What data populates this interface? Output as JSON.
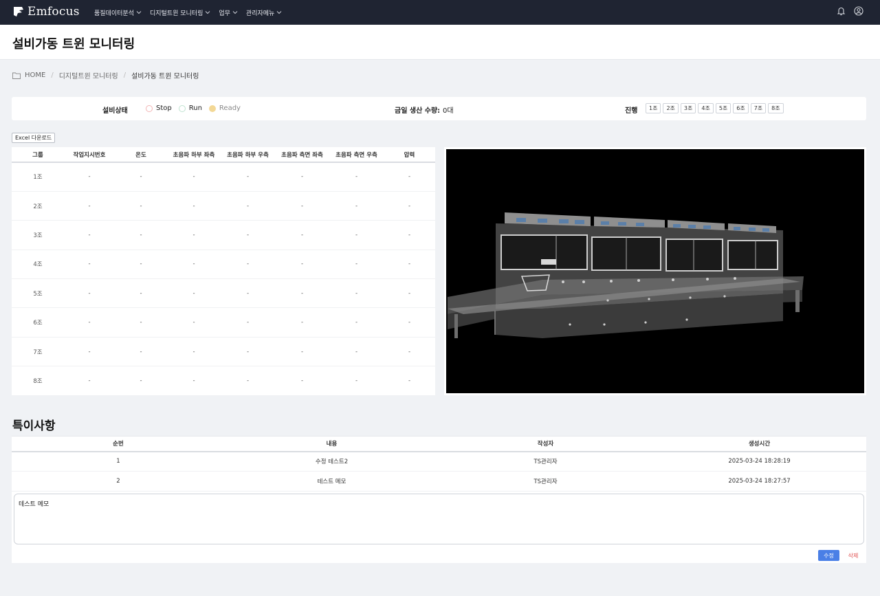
{
  "header": {
    "brand": "Emfocus",
    "nav": [
      "품질데이터분석",
      "디지털트윈 모니터링",
      "업무",
      "관리자메뉴"
    ]
  },
  "page": {
    "title": "설비가동 트윈 모니터링"
  },
  "breadcrumb": {
    "home": "HOME",
    "section": "디지털트윈 모니터링",
    "current": "설비가동 트윈 모니터링"
  },
  "status": {
    "label": "설비상태",
    "legend": [
      {
        "label": "Stop",
        "color": "#f2b4b4"
      },
      {
        "label": "Run",
        "color": "#bfe3d0"
      },
      {
        "label": "Ready",
        "color": "#f3d896"
      }
    ],
    "production_label": "금일 생산 수량:",
    "production_value": "0대",
    "progress_label": "진행",
    "groups": [
      "1조",
      "2조",
      "3조",
      "4조",
      "5조",
      "6조",
      "7조",
      "8조"
    ]
  },
  "excel_button": "Excel 다운로드",
  "data_table": {
    "headers": [
      "그룹",
      "작업지시번호",
      "온도",
      "초음파 하부 좌측",
      "초음파 하부 우측",
      "초음파 측면 좌측",
      "초음파 측면 우측",
      "압력"
    ],
    "rows": [
      [
        "1조",
        "-",
        "-",
        "-",
        "-",
        "-",
        "-",
        "-"
      ],
      [
        "2조",
        "-",
        "-",
        "-",
        "-",
        "-",
        "-",
        "-"
      ],
      [
        "3조",
        "-",
        "-",
        "-",
        "-",
        "-",
        "-",
        "-"
      ],
      [
        "4조",
        "-",
        "-",
        "-",
        "-",
        "-",
        "-",
        "-"
      ],
      [
        "5조",
        "-",
        "-",
        "-",
        "-",
        "-",
        "-",
        "-"
      ],
      [
        "6조",
        "-",
        "-",
        "-",
        "-",
        "-",
        "-",
        "-"
      ],
      [
        "7조",
        "-",
        "-",
        "-",
        "-",
        "-",
        "-",
        "-"
      ],
      [
        "8조",
        "-",
        "-",
        "-",
        "-",
        "-",
        "-",
        "-"
      ]
    ]
  },
  "notes": {
    "title": "특이사항",
    "headers": [
      "순번",
      "내용",
      "작성자",
      "생성시간"
    ],
    "rows": [
      [
        "1",
        "수정 테스트2",
        "TS관리자",
        "2025-03-24 18:28:19"
      ],
      [
        "2",
        "테스트 메모",
        "TS관리자",
        "2025-03-24 18:27:57"
      ]
    ],
    "memo_value": "테스트 메모",
    "edit_label": "수정",
    "delete_label": "삭제"
  }
}
